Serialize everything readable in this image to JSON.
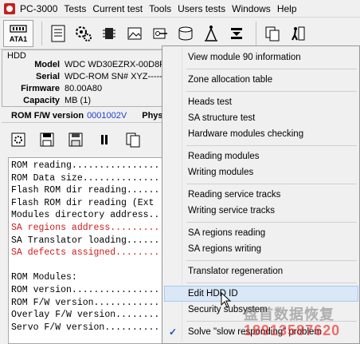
{
  "menubar": {
    "items": [
      "PC-3000",
      "Tests",
      "Current test",
      "Tools",
      "Users tests",
      "Windows",
      "Help"
    ]
  },
  "toolbar": {
    "ata_label": "ATA1",
    "icons": [
      "port-icon",
      "document-icon",
      "gears-icon",
      "chip-icon",
      "image-icon",
      "key-icon",
      "disk-icon",
      "compass-icon",
      "stack-icon",
      "copy-icon",
      "exit-icon"
    ]
  },
  "hdd": {
    "title": "HDD",
    "fields": [
      {
        "label": "Model",
        "value": "WDC WD30EZRX-00D8PI"
      },
      {
        "label": "Serial",
        "value": "WDC-ROM SN# XYZ------"
      },
      {
        "label": "Firmware",
        "value": "80.00A80"
      },
      {
        "label": "Capacity",
        "value": "MB (1)"
      }
    ]
  },
  "rom": {
    "title": "ROM F/W version",
    "version": "0001002V",
    "phys_label": "Phys"
  },
  "log": {
    "lines": [
      {
        "text": "ROM reading...................",
        "color": "#000000"
      },
      {
        "text": "ROM Data size.................",
        "color": "#000000"
      },
      {
        "text": "Flash ROM dir reading.........",
        "color": "#000000"
      },
      {
        "text": "Flash ROM dir reading (Ext",
        "color": "#000000"
      },
      {
        "text": "Modules directory address.....",
        "color": "#000000"
      },
      {
        "text": "SA regions address............",
        "color": "#d01818"
      },
      {
        "text": "SA Translator loading.........",
        "color": "#000000"
      },
      {
        "text": "SA defects assigned...........",
        "color": "#d01818"
      },
      {
        "text": "",
        "color": "#000000"
      },
      {
        "text": "ROM Modules:",
        "color": "#000000"
      },
      {
        "text": "ROM version...................",
        "color": "#000000"
      },
      {
        "text": "ROM F/W version...............",
        "color": "#000000"
      },
      {
        "text": "Overlay F/W version...........",
        "color": "#000000"
      },
      {
        "text": "Servo F/W version.............",
        "color": "#000000"
      }
    ]
  },
  "context_menu": {
    "items": [
      "View module 90 information",
      "Zone allocation table",
      "Heads test",
      "SA structure test",
      "Hardware modules checking",
      "Reading modules",
      "Writing modules",
      "Reading service tracks",
      "Writing service tracks",
      "SA regions reading",
      "SA regions writing",
      "Translator regeneration",
      "Edit HDD ID",
      "Security subsystem",
      "Solve \"slow responding\" problem"
    ],
    "hover_index": 12,
    "checked_index": 14
  },
  "watermark": {
    "text": "盘首数据恢复",
    "phone": "18913587620"
  }
}
